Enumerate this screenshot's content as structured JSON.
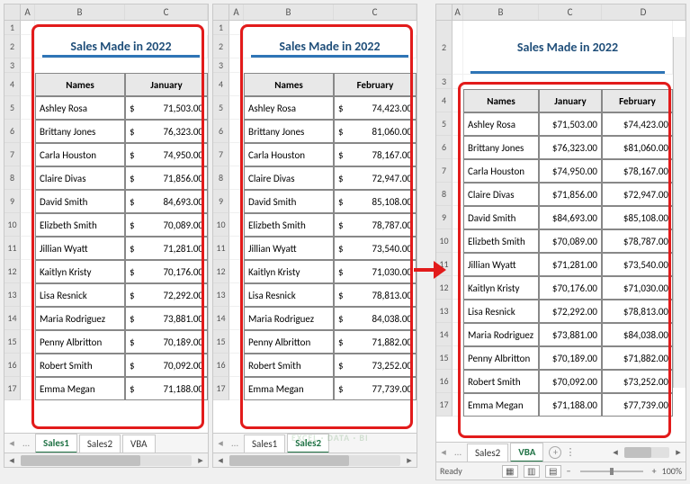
{
  "title": "Sales Made in 2022",
  "months": {
    "jan": "January",
    "feb": "February"
  },
  "col_names": "Names",
  "colLetters2": [
    "A",
    "B",
    "C"
  ],
  "colLetters3": [
    "A",
    "B",
    "C",
    "D"
  ],
  "tabs": {
    "s1": "Sales1",
    "s2": "Sales2",
    "vba": "VBA"
  },
  "status": {
    "ready": "Ready",
    "zoom": "100%"
  },
  "sheet1": [
    {
      "name": "Ashley Rosa",
      "v": "71,503.00"
    },
    {
      "name": "Brittany Jones",
      "v": "76,323.00"
    },
    {
      "name": "Carla Houston",
      "v": "74,950.00"
    },
    {
      "name": "Claire Divas",
      "v": "71,856.00"
    },
    {
      "name": "David Smith",
      "v": "84,693.00"
    },
    {
      "name": "Elizbeth Smith",
      "v": "70,089.00"
    },
    {
      "name": "Jillian Wyatt",
      "v": "71,281.00"
    },
    {
      "name": "Kaitlyn Kristy",
      "v": "70,176.00"
    },
    {
      "name": "Lisa Resnick",
      "v": "72,292.00"
    },
    {
      "name": "Maria Rodriguez",
      "v": "73,881.00"
    },
    {
      "name": "Penny Albritton",
      "v": "70,189.00"
    },
    {
      "name": "Robert Smith",
      "v": "70,092.00"
    },
    {
      "name": "Emma Megan",
      "v": "71,188.00"
    }
  ],
  "sheet2": [
    {
      "name": "Ashley Rosa",
      "v": "74,423.00"
    },
    {
      "name": "Brittany Jones",
      "v": "81,060.00"
    },
    {
      "name": "Carla Houston",
      "v": "78,167.00"
    },
    {
      "name": "Claire Divas",
      "v": "72,947.00"
    },
    {
      "name": "David Smith",
      "v": "85,108.00"
    },
    {
      "name": "Elizbeth Smith",
      "v": "78,787.00"
    },
    {
      "name": "Jillian Wyatt",
      "v": "73,540.00"
    },
    {
      "name": "Kaitlyn Kristy",
      "v": "71,030.00"
    },
    {
      "name": "Lisa Resnick",
      "v": "78,813.00"
    },
    {
      "name": "Maria Rodriguez",
      "v": "84,038.00"
    },
    {
      "name": "Penny Albritton",
      "v": "71,882.00"
    },
    {
      "name": "Robert Smith",
      "v": "73,252.00"
    },
    {
      "name": "Emma Megan",
      "v": "77,739.00"
    }
  ],
  "merged": [
    {
      "name": "Ashley Rosa",
      "a": "$71,503.00",
      "b": "$74,423.00"
    },
    {
      "name": "Brittany Jones",
      "a": "$76,323.00",
      "b": "$81,060.00"
    },
    {
      "name": "Carla Houston",
      "a": "$74,950.00",
      "b": "$78,167.00"
    },
    {
      "name": "Claire Divas",
      "a": "$71,856.00",
      "b": "$72,947.00"
    },
    {
      "name": "David Smith",
      "a": "$84,693.00",
      "b": "$85,108.00"
    },
    {
      "name": "Elizbeth Smith",
      "a": "$70,089.00",
      "b": "$78,787.00"
    },
    {
      "name": "Jillian Wyatt",
      "a": "$71,281.00",
      "b": "$73,540.00"
    },
    {
      "name": "Kaitlyn Kristy",
      "a": "$70,176.00",
      "b": "$71,030.00"
    },
    {
      "name": "Lisa Resnick",
      "a": "$72,292.00",
      "b": "$78,813.00"
    },
    {
      "name": "Maria Rodriguez",
      "a": "$73,881.00",
      "b": "$84,038.00"
    },
    {
      "name": "Penny Albritton",
      "a": "$70,189.00",
      "b": "$71,882.00"
    },
    {
      "name": "Robert Smith",
      "a": "$70,092.00",
      "b": "$73,252.00"
    },
    {
      "name": "Emma Megan",
      "a": "$71,188.00",
      "b": "$77,739.00"
    }
  ],
  "chart_data": {
    "type": "table",
    "title": "Sales Made in 2022",
    "columns": [
      "Names",
      "January",
      "February"
    ],
    "rows": [
      [
        "Ashley Rosa",
        71503.0,
        74423.0
      ],
      [
        "Brittany Jones",
        76323.0,
        81060.0
      ],
      [
        "Carla Houston",
        74950.0,
        78167.0
      ],
      [
        "Claire Divas",
        71856.0,
        72947.0
      ],
      [
        "David Smith",
        84693.0,
        85108.0
      ],
      [
        "Elizbeth Smith",
        70089.0,
        78787.0
      ],
      [
        "Jillian Wyatt",
        71281.0,
        73540.0
      ],
      [
        "Kaitlyn Kristy",
        70176.0,
        71030.0
      ],
      [
        "Lisa Resnick",
        72292.0,
        78813.0
      ],
      [
        "Maria Rodriguez",
        73881.0,
        84038.0
      ],
      [
        "Penny Albritton",
        70189.0,
        71882.0
      ],
      [
        "Robert Smith",
        70092.0,
        73252.0
      ],
      [
        "Emma Megan",
        71188.0,
        77739.0
      ]
    ]
  }
}
